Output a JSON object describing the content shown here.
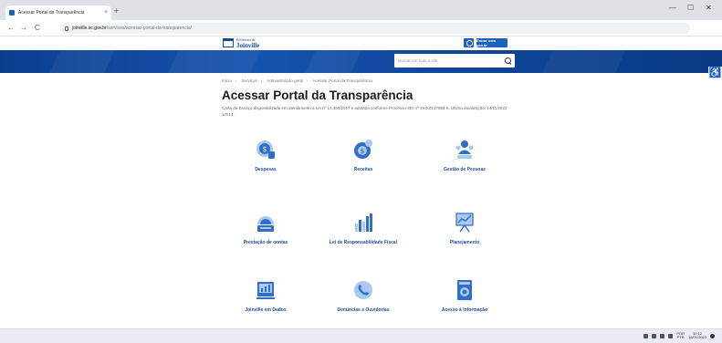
{
  "browser": {
    "tab_title": "Acessar Portal da Transparência",
    "new_tab": "+",
    "url_domain": "joinville.sc.gov.br",
    "url_path": "/servicos/acessar-portal-da-transparencia/",
    "back": "←",
    "forward": "→",
    "reload": "C",
    "minimize": "—",
    "maximize": "☐",
    "close": "✕"
  },
  "header": {
    "logo_small": "Prefeitura de",
    "logo_big": "Joinville",
    "login_label": "Entrar com gov.br"
  },
  "banner": {
    "search_placeholder": "Buscar em todo o site"
  },
  "content": {
    "breadcrumb": [
      "Início",
      "Serviços",
      "Administração geral",
      "Acessar Portal da Transparência"
    ],
    "title": "Acessar Portal da Transparência",
    "description": "Carta de Serviço disponibilizada em atendimento à Lei nº 13.460/2017 e adotada conforme Processo SEI nº 19.0.0137868-8. Última atualização: 14/11/2022 17h14."
  },
  "cards": [
    {
      "label": "Despesas",
      "icon": "expenses-icon"
    },
    {
      "label": "Receitas",
      "icon": "revenue-icon"
    },
    {
      "label": "Gestão de Pessoas",
      "icon": "people-icon"
    },
    {
      "label": "Prestação de contas",
      "icon": "accountability-icon"
    },
    {
      "label": "Lei de Responsabilidade Fiscal",
      "icon": "fiscal-law-icon"
    },
    {
      "label": "Planejamento",
      "icon": "planning-icon"
    },
    {
      "label": "Joinville em Dados",
      "icon": "data-icon"
    },
    {
      "label": "Denúncias e Ouvidorias",
      "icon": "ombudsman-icon"
    },
    {
      "label": "Acesso à Informação",
      "icon": "information-icon"
    }
  ],
  "taskbar": {
    "language": "POR",
    "language_sub": "PTB",
    "time": "10:12",
    "date": "16/01/2023"
  },
  "colors": {
    "banner": "#1553ad",
    "accent": "#1f60b8",
    "card_label": "#1f4f9e",
    "icon_main": "#2f6fc7",
    "icon_light": "#a9c9ef"
  }
}
